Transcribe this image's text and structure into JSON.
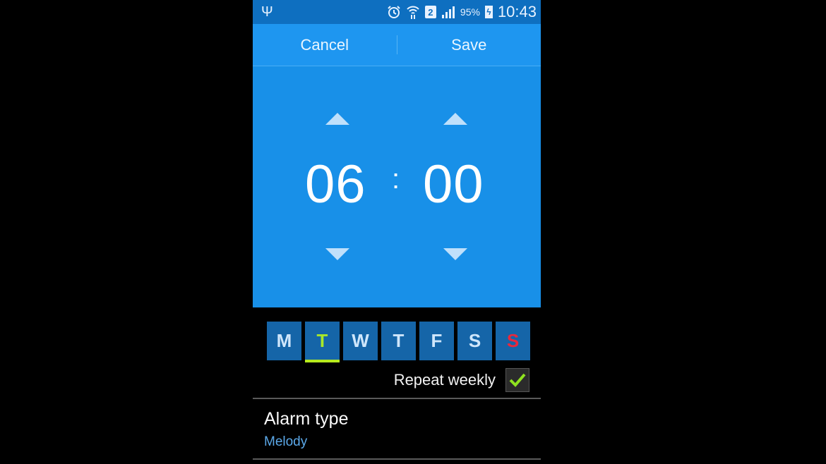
{
  "status_bar": {
    "left_icon": "usb-icon",
    "icons": [
      "alarm-clock-icon",
      "wifi-icon",
      "sim-2-icon",
      "signal-icon",
      "battery-charging-icon"
    ],
    "sim_label": "2",
    "battery_percent": "95%",
    "time": "10:43"
  },
  "action_bar": {
    "cancel_label": "Cancel",
    "save_label": "Save"
  },
  "time_picker": {
    "hour": "06",
    "separator": ":",
    "minute": "00"
  },
  "days": [
    {
      "label": "M",
      "day": "Monday",
      "selected": false
    },
    {
      "label": "T",
      "day": "Tuesday",
      "selected": true
    },
    {
      "label": "W",
      "day": "Wednesday",
      "selected": false
    },
    {
      "label": "T",
      "day": "Thursday",
      "selected": false
    },
    {
      "label": "F",
      "day": "Friday",
      "selected": false
    },
    {
      "label": "S",
      "day": "Saturday",
      "selected": false
    },
    {
      "label": "S",
      "day": "Sunday",
      "selected": false
    }
  ],
  "repeat": {
    "label": "Repeat weekly",
    "checked": true
  },
  "alarm_type": {
    "title": "Alarm type",
    "value": "Melody"
  },
  "colors": {
    "status_bar": "#0e6fc0",
    "action_bar": "#1e96f0",
    "picker_bg": "#1890e8",
    "day_bg": "#1565a8",
    "selected_day": "#a8e82a",
    "sunday": "#e8283c",
    "subtitle": "#5ba8e8"
  }
}
